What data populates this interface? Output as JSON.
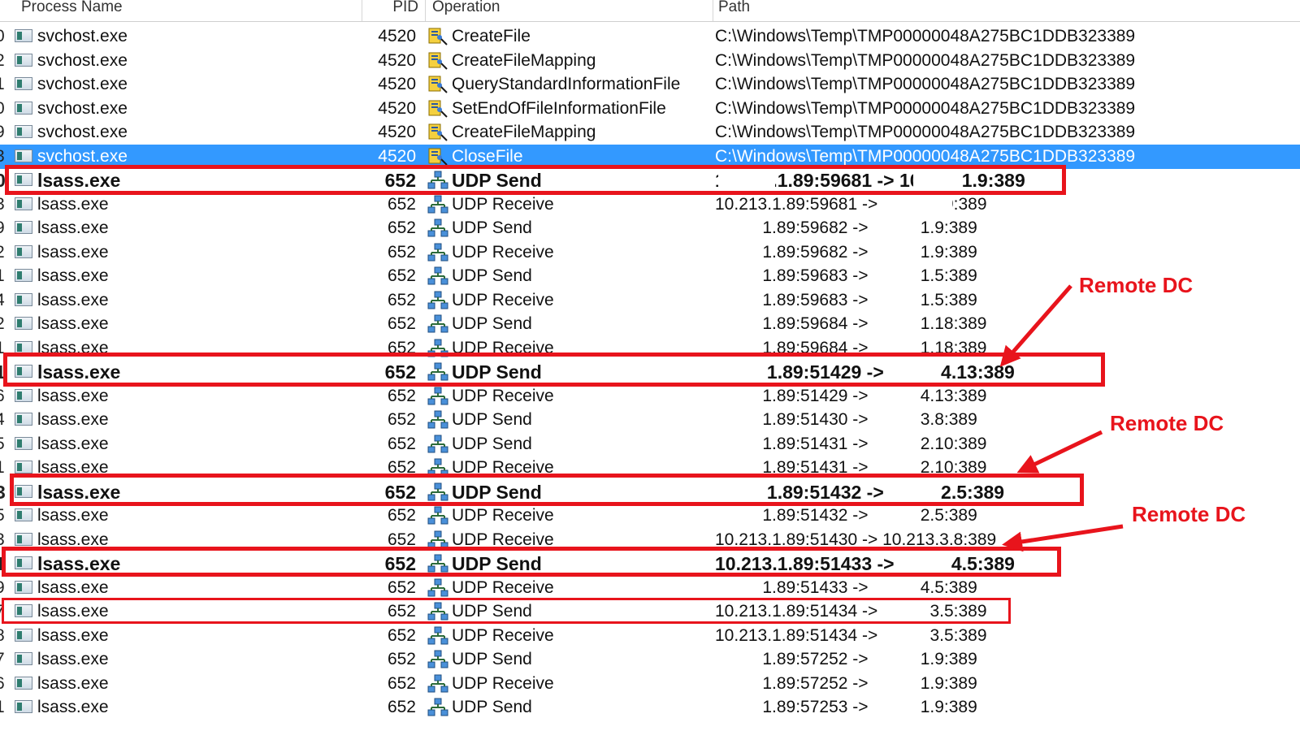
{
  "columns": [
    "Process Name",
    "PID",
    "Operation",
    "Path"
  ],
  "rows": [
    {
      "num": "0",
      "process": "svchost.exe",
      "pid": "4520",
      "op": "CreateFile",
      "op_icon": "file-system-icon",
      "path": "C:\\Windows\\Temp\\TMP00000048A275BC1DDB323389",
      "style": "normal"
    },
    {
      "num": "2",
      "process": "svchost.exe",
      "pid": "4520",
      "op": "CreateFileMapping",
      "op_icon": "file-system-icon",
      "path": "C:\\Windows\\Temp\\TMP00000048A275BC1DDB323389",
      "style": "normal"
    },
    {
      "num": "1",
      "process": "svchost.exe",
      "pid": "4520",
      "op": "QueryStandardInformationFile",
      "op_icon": "file-system-icon",
      "path": "C:\\Windows\\Temp\\TMP00000048A275BC1DDB323389",
      "style": "normal"
    },
    {
      "num": "0",
      "process": "svchost.exe",
      "pid": "4520",
      "op": "SetEndOfFileInformationFile",
      "op_icon": "file-system-icon",
      "path": "C:\\Windows\\Temp\\TMP00000048A275BC1DDB323389",
      "style": "normal"
    },
    {
      "num": "9",
      "process": "svchost.exe",
      "pid": "4520",
      "op": "CreateFileMapping",
      "op_icon": "file-system-icon",
      "path": "C:\\Windows\\Temp\\TMP00000048A275BC1DDB323389",
      "style": "normal"
    },
    {
      "num": "3",
      "process": "svchost.exe",
      "pid": "4520",
      "op": "CloseFile",
      "op_icon": "file-system-icon",
      "path": "C:\\Windows\\Temp\\TMP00000048A275BC1DDB323389",
      "style": "selected"
    },
    {
      "num": "0",
      "process": "lsass.exe",
      "pid": "652",
      "op": "UDP Send",
      "op_icon": "network-icon",
      "path": "10.213.1.89:59681 -> 10.213.1.9:389",
      "style": "bold"
    },
    {
      "num": "3",
      "process": "lsass.exe",
      "pid": "652",
      "op": "UDP Receive",
      "op_icon": "network-icon",
      "path": "10.213.1.89:59681 ->           1.9:389",
      "style": "normal"
    },
    {
      "num": "9",
      "process": "lsass.exe",
      "pid": "652",
      "op": "UDP Send",
      "op_icon": "network-icon",
      "path": "          1.89:59682 ->           1.9:389",
      "style": "normal"
    },
    {
      "num": "2",
      "process": "lsass.exe",
      "pid": "652",
      "op": "UDP Receive",
      "op_icon": "network-icon",
      "path": "          1.89:59682 ->           1.9:389",
      "style": "normal"
    },
    {
      "num": "1",
      "process": "lsass.exe",
      "pid": "652",
      "op": "UDP Send",
      "op_icon": "network-icon",
      "path": "          1.89:59683 ->           1.5:389",
      "style": "normal"
    },
    {
      "num": "4",
      "process": "lsass.exe",
      "pid": "652",
      "op": "UDP Receive",
      "op_icon": "network-icon",
      "path": "          1.89:59683 ->           1.5:389",
      "style": "normal"
    },
    {
      "num": "2",
      "process": "lsass.exe",
      "pid": "652",
      "op": "UDP Send",
      "op_icon": "network-icon",
      "path": "          1.89:59684 ->           1.18:389",
      "style": "normal"
    },
    {
      "num": "1",
      "process": "lsass.exe",
      "pid": "652",
      "op": "UDP Receive",
      "op_icon": "network-icon",
      "path": "          1.89:59684 ->           1.18:389",
      "style": "normal"
    },
    {
      "num": "1",
      "process": "lsass.exe",
      "pid": "652",
      "op": "UDP Send",
      "op_icon": "network-icon",
      "path": "          1.89:51429 ->           4.13:389",
      "style": "bold"
    },
    {
      "num": "6",
      "process": "lsass.exe",
      "pid": "652",
      "op": "UDP Receive",
      "op_icon": "network-icon",
      "path": "          1.89:51429 ->           4.13:389",
      "style": "normal"
    },
    {
      "num": "4",
      "process": "lsass.exe",
      "pid": "652",
      "op": "UDP Send",
      "op_icon": "network-icon",
      "path": "          1.89:51430 ->           3.8:389",
      "style": "normal"
    },
    {
      "num": "5",
      "process": "lsass.exe",
      "pid": "652",
      "op": "UDP Send",
      "op_icon": "network-icon",
      "path": "          1.89:51431 ->           2.10:389",
      "style": "normal"
    },
    {
      "num": "1",
      "process": "lsass.exe",
      "pid": "652",
      "op": "UDP Receive",
      "op_icon": "network-icon",
      "path": "          1.89:51431 ->           2.10:389",
      "style": "normal"
    },
    {
      "num": "3",
      "process": "lsass.exe",
      "pid": "652",
      "op": "UDP Send",
      "op_icon": "network-icon",
      "path": "          1.89:51432 ->           2.5:389",
      "style": "bold"
    },
    {
      "num": "5",
      "process": "lsass.exe",
      "pid": "652",
      "op": "UDP Receive",
      "op_icon": "network-icon",
      "path": "          1.89:51432 ->           2.5:389",
      "style": "normal"
    },
    {
      "num": "3",
      "process": "lsass.exe",
      "pid": "652",
      "op": "UDP Receive",
      "op_icon": "network-icon",
      "path": "10.213.1.89:51430 -> 10.213.3.8:389",
      "style": "normal"
    },
    {
      "num": "1",
      "process": "lsass.exe",
      "pid": "652",
      "op": "UDP Send",
      "op_icon": "network-icon",
      "path": "10.213.1.89:51433 ->           4.5:389",
      "style": "bold"
    },
    {
      "num": "9",
      "process": "lsass.exe",
      "pid": "652",
      "op": "UDP Receive",
      "op_icon": "network-icon",
      "path": "          1.89:51433 ->           4.5:389",
      "style": "normal"
    },
    {
      "num": "7",
      "process": "lsass.exe",
      "pid": "652",
      "op": "UDP Send",
      "op_icon": "network-icon",
      "path": "10.213.1.89:51434 ->           3.5:389",
      "style": "normal"
    },
    {
      "num": "8",
      "process": "lsass.exe",
      "pid": "652",
      "op": "UDP Receive",
      "op_icon": "network-icon",
      "path": "10.213.1.89:51434 ->           3.5:389",
      "style": "normal"
    },
    {
      "num": "7",
      "process": "lsass.exe",
      "pid": "652",
      "op": "UDP Send",
      "op_icon": "network-icon",
      "path": "          1.89:57252 ->           1.9:389",
      "style": "normal"
    },
    {
      "num": "6",
      "process": "lsass.exe",
      "pid": "652",
      "op": "UDP Receive",
      "op_icon": "network-icon",
      "path": "          1.89:57252 ->           1.9:389",
      "style": "normal"
    },
    {
      "num": "1",
      "process": "lsass.exe",
      "pid": "652",
      "op": "UDP Send",
      "op_icon": "network-icon",
      "path": "          1.89:57253 ->           1.9:389",
      "style": "normal"
    }
  ],
  "annotations": {
    "callouts": [
      "Remote DC",
      "Remote DC",
      "Remote DC"
    ],
    "highlight_color": "#e8141c",
    "selection_color": "#3399ff"
  }
}
